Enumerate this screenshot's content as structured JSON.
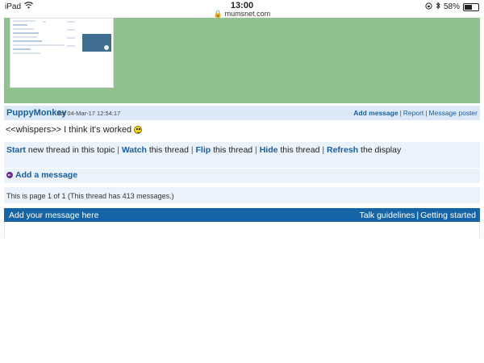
{
  "status_bar": {
    "device": "iPad",
    "time": "13:00",
    "url": "mumsnet.com",
    "battery_text": "58%",
    "battery_level": 0.58
  },
  "post": {
    "author": "PuppyMonkey",
    "date": "Sat 04-Mar-17 12:54:17",
    "actions": {
      "add_message": "Add message",
      "report": "Report",
      "message_poster": "Message poster"
    },
    "body": "<<whispers>> I think it's worked",
    "emoji": "smiley-icon"
  },
  "thread_actions": {
    "start": "Start",
    "start_rest": "new thread in this topic",
    "watch": "Watch",
    "watch_rest": "this thread",
    "flip": "Flip",
    "flip_rest": "this thread",
    "hide": "Hide",
    "hide_rest": "this thread",
    "refresh": "Refresh",
    "refresh_rest": "the display"
  },
  "add_message_link": "Add a message",
  "page_info": "This is page 1 of 1 (This thread has 413 messages.)",
  "reply": {
    "title": "Add your message here",
    "talk_guidelines": "Talk guidelines",
    "getting_started": "Getting started"
  },
  "colors": {
    "link": "#1a5ea3",
    "header_bg": "#dbe9f6",
    "reply_bar": "#1565a6",
    "green_bg": "#8fc18f"
  }
}
